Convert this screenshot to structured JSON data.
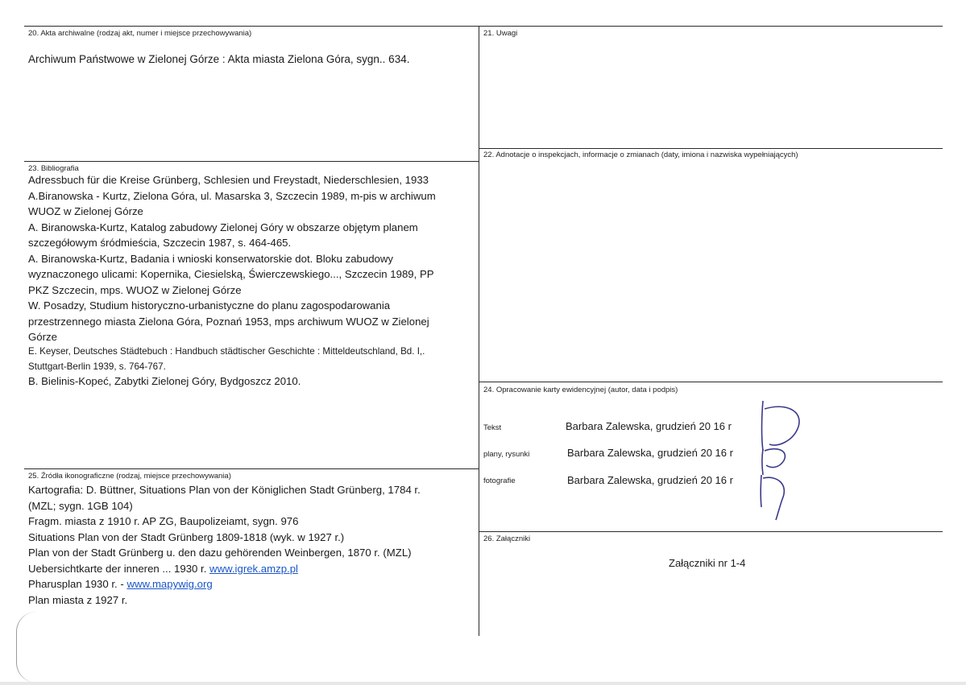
{
  "s20": {
    "label": "20. Akta archiwalne (rodzaj akt, numer i miejsce przechowywania)",
    "text": "Archiwum Państwowe w Zielonej Górze : Akta miasta Zielona Góra, sygn.. 634."
  },
  "s21": {
    "label": "21. Uwagi"
  },
  "s22": {
    "label": "22. Adnotacje o inspekcjach, informacje o zmianach (daty, imiona i nazwiska wypełniających)"
  },
  "s23": {
    "label": "23. Bibliografia",
    "lines": [
      "Adressbuch für die Kreise Grünberg, Schlesien und Freystadt, Niederschlesien, 1933",
      "A.Biranowska - Kurtz, Zielona Góra, ul. Masarska 3, Szczecin 1989, m-pis w archiwum",
      "WUOZ w Zielonej Górze",
      "A. Biranowska-Kurtz, Katalog zabudowy Zielonej Góry w obszarze objętym planem",
      "szczegółowym śródmieścia, Szczecin 1987, s. 464-465.",
      "A. Biranowska-Kurtz, Badania i wnioski konserwatorskie dot. Bloku zabudowy",
      "wyznaczonego ulicami: Kopernika, Ciesielską, Świerczewskiego..., Szczecin 1989, PP",
      "PKZ Szczecin, mps. WUOZ w Zielonej Górze",
      "W. Posadzy, Studium historyczno-urbanistyczne do planu zagospodarowania",
      "przestrzennego miasta Zielona Góra, Poznań 1953, mps archiwum WUOZ w Zielonej",
      "Górze"
    ],
    "keyser_line1": "E. Keyser, Deutsches Städtebuch : Handbuch städtischer Geschichte : Mitteldeutschland, Bd. I,.",
    "keyser_line2": "Stuttgart-Berlin 1939, s. 764-767.",
    "last_line": "B. Bielinis-Kopeć, Zabytki Zielonej Góry, Bydgoszcz 2010."
  },
  "s24": {
    "label": "24. Opracowanie karty ewidencyjnej (autor, data i podpis)",
    "rows": [
      {
        "key": "Tekst",
        "value": "Barbara Zalewska, grudzień 20 16 r"
      },
      {
        "key": "plany, rysunki",
        "value": "Barbara Zalewska, grudzień 20 16 r"
      },
      {
        "key": "fotografie",
        "value": "Barbara Zalewska, grudzień 20 16 r"
      }
    ]
  },
  "s25": {
    "label": "25. Źródła ikonograficzne (rodzaj, miejsce przechowywania)",
    "lines": [
      "Kartografia: D. Büttner, Situations Plan von der Königlichen Stadt Grünberg, 1784 r.",
      "(MZL; sygn. 1GB 104)",
      "Fragm. miasta z 1910 r. AP ZG, Baupolizeiamt, sygn. 976",
      "Situations Plan von der Stadt Grünberg 1809-1818 (wyk. w 1927 r.)",
      "Plan von der Stadt Grünberg u. den dazu gehörenden Weinbergen, 1870 r. (MZL)"
    ],
    "uebersicht_prefix": "Uebersichtkarte der inneren ... 1930 r. ",
    "uebersicht_link": "www.igrek.amzp.pl",
    "pharus_prefix": "Pharusplan 1930 r. - ",
    "pharus_link": "www.mapywig.org",
    "last_line": "Plan miasta z 1927 r."
  },
  "s26": {
    "label": "26. Załączniki",
    "text": "Załączniki nr 1-4"
  },
  "colors": {
    "ink": "#1a1a1a",
    "rule": "#2a2a2a",
    "link": "#1a56c8",
    "signature": "#3a3a8a"
  }
}
